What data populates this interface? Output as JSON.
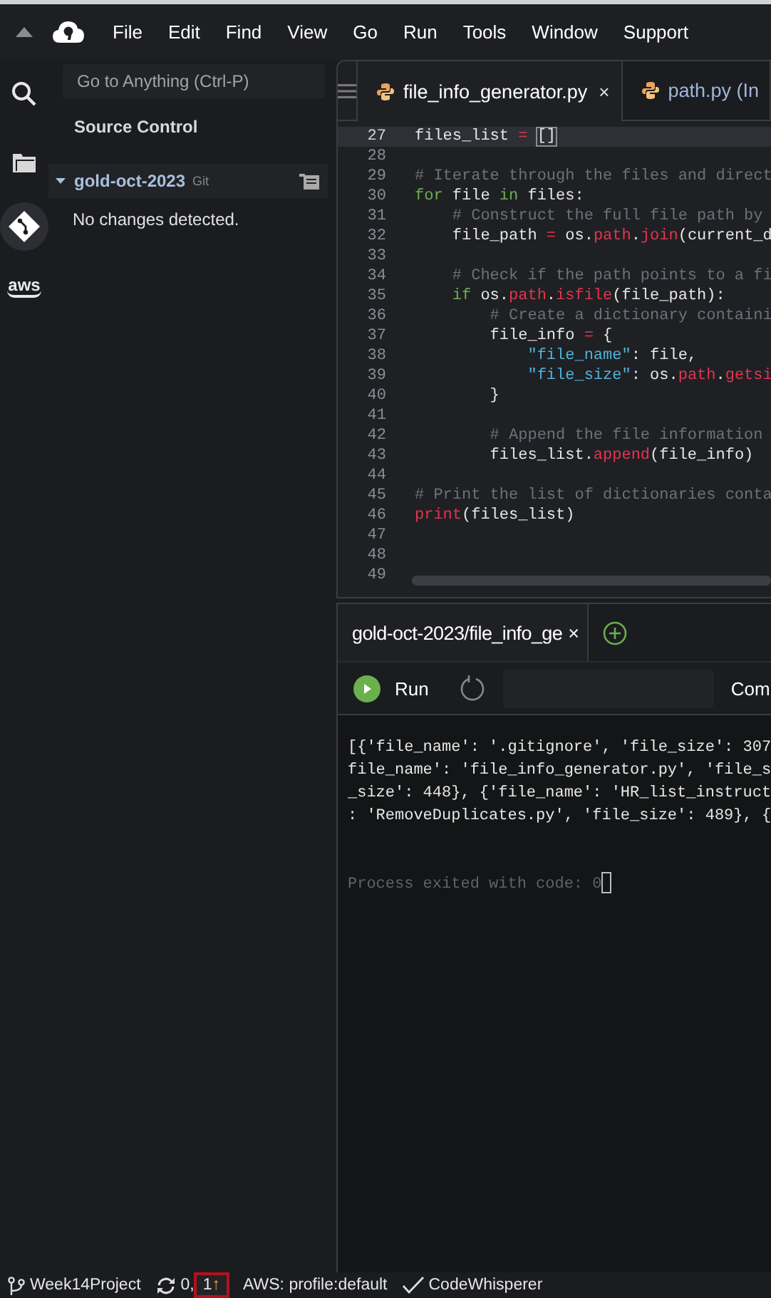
{
  "menu": {
    "items": [
      "File",
      "Edit",
      "Find",
      "View",
      "Go",
      "Run",
      "Tools",
      "Window",
      "Support"
    ]
  },
  "rail": [
    {
      "kind": "search",
      "selected": false
    },
    {
      "kind": "files",
      "selected": false
    },
    {
      "kind": "git",
      "selected": true
    },
    {
      "kind": "aws",
      "label": "aws",
      "selected": false
    }
  ],
  "sidebar": {
    "search": {
      "placeholder": "Go to Anything (Ctrl-P)"
    },
    "title": "Source Control",
    "repo": {
      "name": "gold-oct-2023",
      "tag": "Git",
      "expanded": true
    },
    "message": "No changes detected."
  },
  "editor": {
    "tabs": [
      {
        "label": "file_info_generator.py",
        "selected": true,
        "close": "×"
      },
      {
        "label": "path.py (In",
        "selected": false
      }
    ],
    "lines": [
      {
        "number": "27",
        "current": true,
        "tokens": [
          {
            "kind": "plain",
            "text": "files_list "
          },
          {
            "kind": "op",
            "text": "= "
          },
          {
            "kind": "bracket",
            "text": "[]"
          }
        ]
      },
      {
        "number": "28",
        "current": false
      },
      {
        "number": "29",
        "current": false,
        "tokens": [
          {
            "kind": "comment",
            "text": "# Iterate through the files and direct"
          }
        ]
      },
      {
        "number": "30",
        "current": false,
        "tokens": [
          {
            "kind": "keyword",
            "text": "for"
          },
          {
            "kind": "plain",
            "text": " file "
          },
          {
            "kind": "keyword",
            "text": "in"
          },
          {
            "kind": "plain",
            "text": " files:"
          }
        ]
      },
      {
        "number": "31",
        "current": false,
        "tokens": [
          {
            "kind": "comment",
            "text": "    # Construct the full file path by"
          }
        ]
      },
      {
        "number": "32",
        "current": false,
        "tokens": [
          {
            "kind": "plain",
            "text": "    file_path "
          },
          {
            "kind": "op",
            "text": "="
          },
          {
            "kind": "plain",
            "text": " os."
          },
          {
            "kind": "func",
            "text": "path"
          },
          {
            "kind": "plain",
            "text": "."
          },
          {
            "kind": "func",
            "text": "join"
          },
          {
            "kind": "plain",
            "text": "(current_d"
          }
        ]
      },
      {
        "number": "33",
        "current": false
      },
      {
        "number": "34",
        "current": false,
        "tokens": [
          {
            "kind": "comment",
            "text": "    # Check if the path points to a fi"
          }
        ]
      },
      {
        "number": "35",
        "current": false,
        "tokens": [
          {
            "kind": "keyword",
            "text": "    if"
          },
          {
            "kind": "plain",
            "text": " os."
          },
          {
            "kind": "func",
            "text": "path"
          },
          {
            "kind": "plain",
            "text": "."
          },
          {
            "kind": "func",
            "text": "isfile"
          },
          {
            "kind": "plain",
            "text": "(file_path):"
          }
        ]
      },
      {
        "number": "36",
        "current": false,
        "tokens": [
          {
            "kind": "comment",
            "text": "        # Create a dictionary containi"
          }
        ]
      },
      {
        "number": "37",
        "current": false,
        "tokens": [
          {
            "kind": "plain",
            "text": "        file_info "
          },
          {
            "kind": "op",
            "text": "="
          },
          {
            "kind": "plain",
            "text": " {"
          }
        ]
      },
      {
        "number": "38",
        "current": false,
        "tokens": [
          {
            "kind": "string",
            "text": "            \"file_name\""
          },
          {
            "kind": "plain",
            "text": ": file,"
          }
        ]
      },
      {
        "number": "39",
        "current": false,
        "tokens": [
          {
            "kind": "string",
            "text": "            \"file_size\""
          },
          {
            "kind": "plain",
            "text": ": os."
          },
          {
            "kind": "func",
            "text": "path"
          },
          {
            "kind": "plain",
            "text": "."
          },
          {
            "kind": "func",
            "text": "getsi"
          }
        ]
      },
      {
        "number": "40",
        "current": false,
        "tokens": [
          {
            "kind": "plain",
            "text": "        }"
          }
        ]
      },
      {
        "number": "41",
        "current": false
      },
      {
        "number": "42",
        "current": false,
        "tokens": [
          {
            "kind": "comment",
            "text": "        # Append the file information"
          }
        ]
      },
      {
        "number": "43",
        "current": false,
        "tokens": [
          {
            "kind": "plain",
            "text": "        files_list."
          },
          {
            "kind": "func",
            "text": "append"
          },
          {
            "kind": "plain",
            "text": "(file_info)"
          }
        ]
      },
      {
        "number": "44",
        "current": false
      },
      {
        "number": "45",
        "current": false,
        "tokens": [
          {
            "kind": "comment",
            "text": "# Print the list of dictionaries conta"
          }
        ]
      },
      {
        "number": "46",
        "current": false,
        "tokens": [
          {
            "kind": "func",
            "text": "print"
          },
          {
            "kind": "plain",
            "text": "(files_list)"
          }
        ]
      },
      {
        "number": "47",
        "current": false
      },
      {
        "number": "48",
        "current": false
      },
      {
        "number": "49",
        "current": false
      }
    ]
  },
  "terminal": {
    "tab": {
      "label": "gold-oct-2023/file_info_ge",
      "close": "×",
      "selected": true
    },
    "run_label": "Run",
    "command_label": "Com",
    "output": [
      "[{'file_name': '.gitignore', 'file_size': 307",
      "file_name': 'file_info_generator.py', 'file_s",
      "_size': 448}, {'file_name': 'HR_list_instruct",
      ": 'RemoveDuplicates.py', 'file_size': 489}, {"
    ],
    "exit_message": "Process exited with code: 0"
  },
  "status_bar": [
    {
      "kind": "branch",
      "text": "Week14Project",
      "highlighted": false
    },
    {
      "kind": "sync",
      "text": "0,",
      "highlighted": false
    },
    {
      "kind": "ahead",
      "text": "1",
      "arrow": "↑",
      "highlighted": true
    },
    {
      "kind": "plain",
      "text": "AWS: profile:default",
      "highlighted": false
    },
    {
      "kind": "check",
      "text": "CodeWhisperer",
      "highlighted": false
    }
  ]
}
